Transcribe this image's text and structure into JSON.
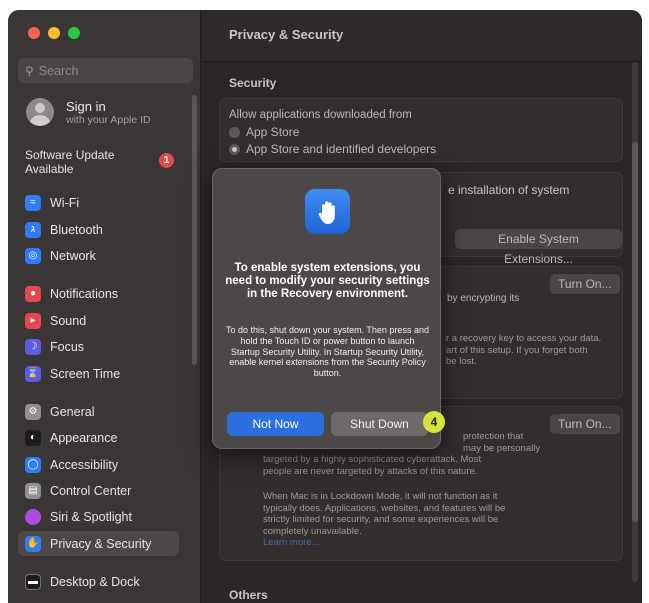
{
  "sidebar": {
    "search_placeholder": "Search",
    "account": {
      "title": "Sign in",
      "subtitle": "with your Apple ID"
    },
    "update": {
      "label": "Software Update Available",
      "badge": "1"
    },
    "items": [
      {
        "label": "Wi-Fi",
        "icon": "wifi-icon",
        "color": "#2f7cf6"
      },
      {
        "label": "Bluetooth",
        "icon": "bluetooth-icon",
        "color": "#2f7cf6"
      },
      {
        "label": "Network",
        "icon": "globe-icon",
        "color": "#2f7cf6"
      },
      {
        "label": "Notifications",
        "icon": "bell-icon",
        "color": "#e5484d"
      },
      {
        "label": "Sound",
        "icon": "speaker-icon",
        "color": "#e5484d"
      },
      {
        "label": "Focus",
        "icon": "moon-icon",
        "color": "#5e5ce6"
      },
      {
        "label": "Screen Time",
        "icon": "hourglass-icon",
        "color": "#5e5ce6"
      },
      {
        "label": "General",
        "icon": "gear-icon",
        "color": "#8e8e93"
      },
      {
        "label": "Appearance",
        "icon": "appearance-icon",
        "color": "#1c1c1e"
      },
      {
        "label": "Accessibility",
        "icon": "accessibility-icon",
        "color": "#2f7cf6"
      },
      {
        "label": "Control Center",
        "icon": "control-center-icon",
        "color": "#8e8e93"
      },
      {
        "label": "Siri & Spotlight",
        "icon": "siri-icon",
        "color": "#b04ae0"
      },
      {
        "label": "Privacy & Security",
        "icon": "hand-icon",
        "color": "#2f7cf6"
      },
      {
        "label": "Desktop & Dock",
        "icon": "dock-icon",
        "color": "#1c1c1e"
      }
    ],
    "active_item": "Privacy & Security"
  },
  "content": {
    "title": "Privacy & Security",
    "security_header": "Security",
    "allow_label": "Allow applications downloaded from",
    "radio_options": [
      "App Store",
      "App Store and identified developers"
    ],
    "selected_radio": "App Store and identified developers",
    "ext_text": "e installation of system",
    "ext_button": "Enable System Extensions...",
    "filevault_button": "Turn On...",
    "filevault_line": "by encrypting its",
    "recovery_lines": [
      "r a recovery key to access your data.",
      "art of this setup. If you forget both",
      "be lost."
    ],
    "lockdown_button": "Turn On...",
    "lockdown_lines": [
      "protection that",
      "may be personally",
      "targeted by a highly sophisticated cyberattack. Most",
      "people are never targeted by attacks of this nature."
    ],
    "lockdown_para2": [
      "When Mac is in Lockdown Mode, it will not function as it",
      "typically does. Applications, websites, and features will be",
      "strictly limited for security, and some experiences will be",
      "completely unavailable."
    ],
    "learn_more": "Learn more...",
    "others_header": "Others"
  },
  "dialog": {
    "title": "To enable system extensions, you need to modify your security settings in the Recovery environment.",
    "body": "To do this, shut down your system. Then press and hold the Touch ID or power button to launch Startup Security Utility. In Startup Security Utility, enable kernel extensions from the Security Policy button.",
    "primary_label": "Not Now",
    "secondary_label": "Shut Down",
    "step_badge": "4"
  }
}
